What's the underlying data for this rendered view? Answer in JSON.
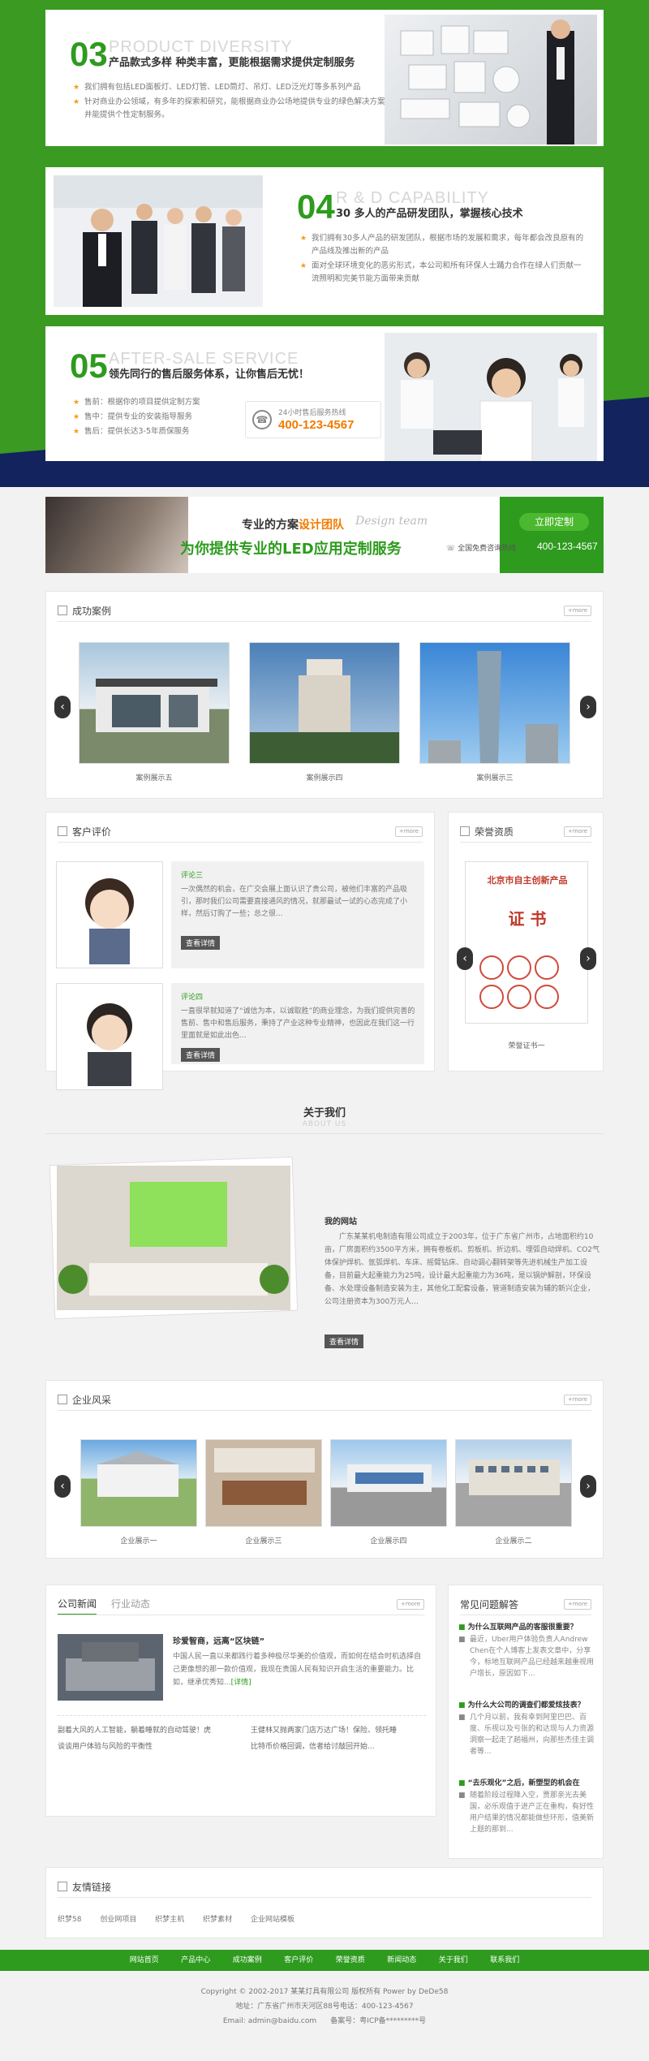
{
  "features": [
    {
      "num": "03",
      "en": "PRODUCT DIVERSITY",
      "cn": "产品款式多样 种类丰富，更能根据需求提供定制服务",
      "points": [
        "我们拥有包括LED面板灯、LED灯管、LED筒灯、吊灯、LED泛光灯等多系列产品",
        "针对商业办公领域，有多年的探索和研究，能根据商业办公场地提供专业的绿色解决方案，并能提供个性定制服务。"
      ]
    },
    {
      "num": "04",
      "en": "R & D CAPABILITY",
      "cn": "30 多人的产品研发团队，掌握核心技术",
      "points": [
        "我们拥有30多人产品的研发团队，根据市场的发展和需求，每年都会改良原有的产品线及推出新的产品",
        "面对全球环境变化的恶劣形式，本公司和所有环保人士踊力合作在绿人们贡献一流照明和完美节能方面带来贡献"
      ]
    },
    {
      "num": "05",
      "en": "AFTER-SALE SERVICE",
      "cn": "领先同行的售后服务体系，让你售后无忧！",
      "points": [
        "售前：根据你的项目提供定制方案",
        "售中：提供专业的安装指导服务",
        "售后：提供长达3-5年质保服务"
      ],
      "hotline_label": "24小时售后服务热线",
      "hotline": "400-123-4567"
    }
  ],
  "banner": {
    "line1_a": "专业的方案",
    "line1_b": "设计团队",
    "script": "Design team",
    "line2": "为你提供专业的LED应用定制服务",
    "button": "立即定制",
    "free_call": "全国免费咨询热线",
    "phone": "400-123-4567"
  },
  "cases": {
    "title": "成功案例",
    "more": "+more",
    "items": [
      "案例展示五",
      "案例展示四",
      "案例展示三"
    ]
  },
  "reviews": {
    "title": "客户评价",
    "more": "+more",
    "items": [
      {
        "name": "评论三",
        "text": "一次偶然的机会，在广交会展上面认识了贵公司，被他们丰富的产品吸引，那时我们公司需要直接通风的情况，就那最试一试的心态完成了小样，然后订购了一些；总之很...",
        "btn": "查看详情"
      },
      {
        "name": "评论四",
        "text": "一直很早就知道了“诚信为本，以诚取胜”的商业理念，为我们提供完善的售前、售中和售后服务，秉持了产业这种专业精神，也因此在我们这一行里面就是如此出色...",
        "btn": "查看详情"
      }
    ]
  },
  "honor": {
    "title": "荣誉资质",
    "more": "+more",
    "caption": "荣誉证书一",
    "cert_title": "北京市自主创新产品",
    "cert_big": "证  书"
  },
  "about": {
    "title": "关于我们",
    "subtitle": "ABOUT US",
    "heading": "我的网站",
    "text": "广东某某机电制造有限公司成立于2003年，位于广东省广州市，占地面积约10亩，厂房面积约3500平方米，拥有卷板机、剪板机、折边机、埋弧自动焊机、CO2气体保护焊机、氩弧焊机、车床、摇臂钻床、自动调心翻转架等先进机械生产加工设备，目前最大起重能力为25吨，设计最大起重能力为36吨，是以锅炉解剖，环保设备、水处理设备制造安装为主，其他化工配套设备，管道制造安装为辅的新兴企业，公司注册资本为300万元人...",
    "btn": "查看详情"
  },
  "style": {
    "title": "企业风采",
    "more": "+more",
    "items": [
      "企业展示一",
      "企业展示三",
      "企业展示四",
      "企业展示二"
    ]
  },
  "news": {
    "tab1": "公司新闻",
    "tab2": "行业动态",
    "more": "+more",
    "feature_title": "珍爱智商，远离“区块链”",
    "feature_text": "中国人民一直以来都践行着多种极尽华美的价值观，而如何在结合时机选择自己更像想的那一款价值观，我现在贵国人民有知识开启生活的重要能力。比如，继承优秀知...",
    "detail": "[详情]",
    "list": [
      "副着大风的人工智能，躺着睡就的自动驾驶！虎",
      "王健林又抛两家门店万达广场！保险、领托睡",
      "谈谈用户体验与风险的平衡性",
      "比特币价格回调，信者给讨敲回开始..."
    ]
  },
  "faq": {
    "title": "常见问题解答",
    "more": "+more",
    "items": [
      {
        "q": "为什么互联网产品的客服很重要？",
        "a": "最近，Uber用户体验负责人Andrew Chen在个人博客上发表文章中，分享今，标地互联网产品已经越来越重视用户增长，原因如下..."
      },
      {
        "q": "为什么大公司的调查们都爱炫技表？",
        "a": "几个月以前，我有幸到阿里巴巴、百度、乐视以及亏张的和达现与人力资源洞察一起走了趟福州，向那些杰佳主调者等..."
      },
      {
        "q": "“去乐观化”之后，新塑型的机会在",
        "a": "随着阶段过程降入空，贾那亲光去美国，必乐观值于进产正在重构，有好性用户结果的情况都能做些环形，值美新上题的那到..."
      }
    ]
  },
  "links": {
    "title": "友情链接",
    "items": [
      "织梦58",
      "创业网项目",
      "织梦主机",
      "织梦素材",
      "企业网站模板"
    ]
  },
  "footer": {
    "nav": [
      "网站首页",
      "产品中心",
      "成功案例",
      "客户评价",
      "荣誉资质",
      "新闻动态",
      "关于我们",
      "联系我们"
    ],
    "copyright": "Copyright © 2002-2017 某某灯具有限公司 版权所有 Power by DeDe58",
    "address": "地址：广东省广州市天河区88号电话：400-123-4567",
    "email": "Email: admin@baidu.com      备案号：粤ICP备*********号"
  },
  "colors": {
    "green": "#3a9a22",
    "navy": "#13235d",
    "accent_orange": "#f27b00"
  }
}
